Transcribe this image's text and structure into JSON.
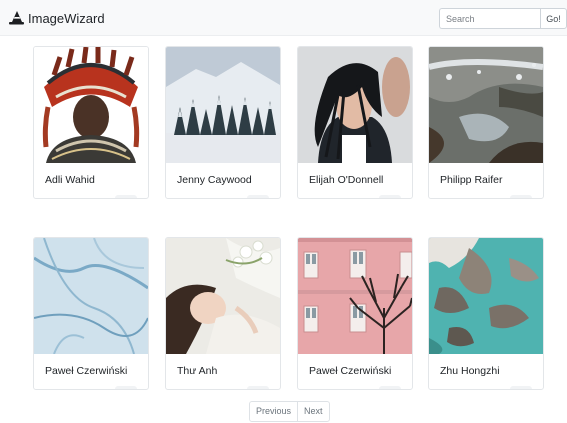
{
  "app": {
    "name": "ImageWizard",
    "logo_icon": "wizard-hat-icon"
  },
  "search": {
    "placeholder": "Search",
    "button_label": "Go!"
  },
  "cards": [
    {
      "title": "Adli Wahid",
      "image": "portrait-feather-headdress",
      "download_icon": "download-icon"
    },
    {
      "title": "Jenny Caywood",
      "image": "snowy-pine-forest",
      "download_icon": "download-icon"
    },
    {
      "title": "Elijah O'Donnell",
      "image": "woman-hair-blowing",
      "download_icon": "download-icon"
    },
    {
      "title": "Philipp Raifer",
      "image": "aerial-winter-valley",
      "download_icon": "download-icon"
    },
    {
      "title": "Paweł Czerwiński",
      "image": "blue-marble-texture",
      "download_icon": "download-icon"
    },
    {
      "title": "Thư Anh",
      "image": "woman-lying-flowers",
      "download_icon": "download-icon"
    },
    {
      "title": "Paweł Czerwiński",
      "image": "pink-building-tree",
      "download_icon": "download-icon"
    },
    {
      "title": "Zhu Hongzhi",
      "image": "aerial-coast-rocks",
      "download_icon": "download-icon"
    }
  ],
  "pagination": {
    "previous_label": "Previous",
    "next_label": "Next"
  }
}
